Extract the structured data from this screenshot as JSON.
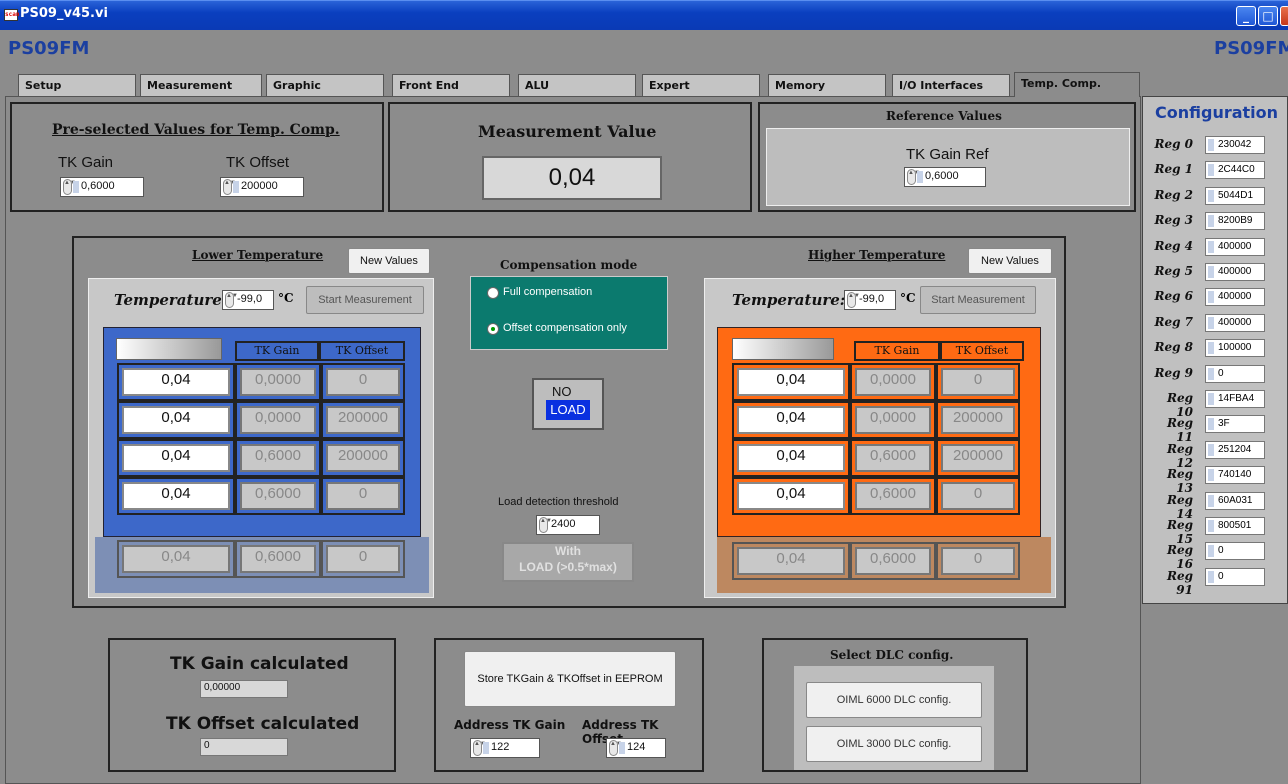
{
  "window": {
    "title": "PS09_v45.vi",
    "brand": "PS09FM",
    "brand_right": "PS09FM"
  },
  "tabs": [
    "Setup",
    "Measurement",
    "Graphic",
    "Front End",
    "ALU",
    "Expert",
    "Memory",
    "I/O Interfaces",
    "Temp. Comp."
  ],
  "active_tab": "Temp. Comp.",
  "preselected": {
    "title": "Pre-selected Values for Temp. Comp.",
    "tk_gain_label": "TK Gain",
    "tk_gain": "0,6000",
    "tk_offset_label": "TK Offset",
    "tk_offset": "200000"
  },
  "measurement": {
    "title": "Measurement Value",
    "value": "0,04"
  },
  "reference": {
    "title": "Reference Values",
    "tk_gain_ref_label": "TK Gain Ref",
    "tk_gain_ref": "0,6000"
  },
  "lower": {
    "title": "Lower Temperature",
    "new_values": "New Values",
    "temperature_label": "Temperature:",
    "temperature": "-99,0",
    "unit": "°C",
    "start": "Start Measurement",
    "col_gain": "TK Gain",
    "col_offset": "TK Offset",
    "rows": [
      [
        "0,04",
        "0,0000",
        "0"
      ],
      [
        "0,04",
        "0,0000",
        "200000"
      ],
      [
        "0,04",
        "0,6000",
        "200000"
      ],
      [
        "0,04",
        "0,6000",
        "0"
      ]
    ],
    "result": [
      "0,04",
      "0,6000",
      "0"
    ]
  },
  "higher": {
    "title": "Higher Temperature",
    "new_values": "New Values",
    "temperature_label": "Temperature:",
    "temperature": "-99,0",
    "unit": "°C",
    "start": "Start Measurement",
    "col_gain": "TK Gain",
    "col_offset": "TK Offset",
    "rows": [
      [
        "0,04",
        "0,0000",
        "0"
      ],
      [
        "0,04",
        "0,0000",
        "200000"
      ],
      [
        "0,04",
        "0,6000",
        "200000"
      ],
      [
        "0,04",
        "0,6000",
        "0"
      ]
    ],
    "result": [
      "0,04",
      "0,6000",
      "0"
    ]
  },
  "compensation": {
    "title": "Compensation mode",
    "options": [
      "Full compensation",
      "Offset compensation only"
    ],
    "selected": "Offset compensation only"
  },
  "load": {
    "line1": "NO",
    "line2": "LOAD",
    "threshold_label": "Load detection threshold",
    "threshold": "2400",
    "with_line1": "With",
    "with_line2": "LOAD (>0.5*max)"
  },
  "calculated": {
    "gain_label": "TK Gain calculated",
    "gain": "0,00000",
    "offset_label": "TK Offset calculated",
    "offset": "0"
  },
  "eeprom": {
    "store": "Store TKGain & TKOffset in EEPROM",
    "addr_gain_label": "Address TK Gain",
    "addr_gain": "122",
    "addr_offset_label": "Address TK Offset",
    "addr_offset": "124"
  },
  "dlc": {
    "title": "Select DLC config.",
    "b6000": "OIML 6000 DLC config.",
    "b3000": "OIML 3000 DLC config."
  },
  "config": {
    "title": "Configuration",
    "regs": [
      {
        "label": "Reg 0",
        "value": "230042"
      },
      {
        "label": "Reg 1",
        "value": "2C44C0"
      },
      {
        "label": "Reg 2",
        "value": "5044D1"
      },
      {
        "label": "Reg 3",
        "value": "8200B9"
      },
      {
        "label": "Reg 4",
        "value": "400000"
      },
      {
        "label": "Reg 5",
        "value": "400000"
      },
      {
        "label": "Reg 6",
        "value": "400000"
      },
      {
        "label": "Reg 7",
        "value": "400000"
      },
      {
        "label": "Reg 8",
        "value": "100000"
      },
      {
        "label": "Reg 9",
        "value": "0"
      },
      {
        "label": "Reg 10",
        "value": "14FBA4"
      },
      {
        "label": "Reg 11",
        "value": "3F"
      },
      {
        "label": "Reg 12",
        "value": "251204"
      },
      {
        "label": "Reg 13",
        "value": "740140"
      },
      {
        "label": "Reg 14",
        "value": "60A031"
      },
      {
        "label": "Reg 15",
        "value": "800501"
      },
      {
        "label": "Reg 16",
        "value": "0"
      },
      {
        "label": "Reg 91",
        "value": "0"
      }
    ]
  },
  "colors": {
    "lower_panel": "#3d68c9",
    "higher_panel": "#ff6a13",
    "comp_panel": "#0b7a6e",
    "title_bar": "#0a3fbf"
  }
}
